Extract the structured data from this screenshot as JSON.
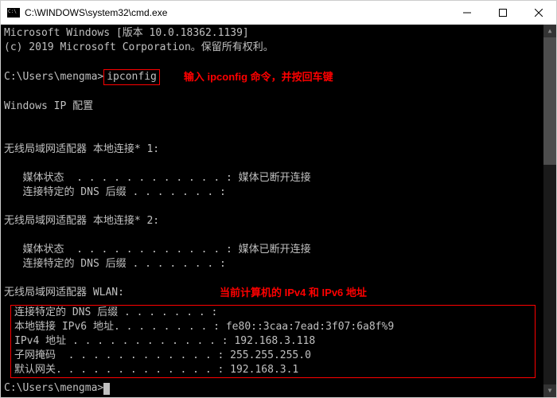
{
  "titlebar": {
    "title": "C:\\WINDOWS\\system32\\cmd.exe"
  },
  "terminal": {
    "header1": "Microsoft Windows [版本 10.0.18362.1139]",
    "header2": "(c) 2019 Microsoft Corporation。保留所有权利。",
    "prompt1_path": "C:\\Users\\mengma>",
    "command": "ipconfig",
    "annotation1": "输入 ipconfig 命令，并按回车键",
    "section_title": "Windows IP 配置",
    "adapter1_title": "无线局域网适配器 本地连接* 1:",
    "adapter1": {
      "media_label": "   媒体状态  . . . . . . . . . . . . : ",
      "media_val": "媒体已断开连接",
      "dns_label": "   连接特定的 DNS 后缀 . . . . . . . :",
      "dns_val": ""
    },
    "adapter2_title": "无线局域网适配器 本地连接* 2:",
    "adapter2": {
      "media_label": "   媒体状态  . . . . . . . . . . . . : ",
      "media_val": "媒体已断开连接",
      "dns_label": "   连接特定的 DNS 后缀 . . . . . . . :",
      "dns_val": ""
    },
    "adapter3_title": "无线局域网适配器 WLAN:",
    "annotation2": "当前计算机的 IPv4 和 IPv6 地址",
    "wlan": {
      "dns_label": "连接特定的 DNS 后缀 . . . . . . . :",
      "ipv6_label": "本地链接 IPv6 地址. . . . . . . . : ",
      "ipv6_val": "fe80::3caa:7ead:3f07:6a8f%9",
      "ipv4_label": "IPv4 地址 . . . . . . . . . . . . : ",
      "ipv4_val": "192.168.3.118",
      "mask_label": "子网掩码  . . . . . . . . . . . . : ",
      "mask_val": "255.255.255.0",
      "gw_label": "默认网关. . . . . . . . . . . . . : ",
      "gw_val": "192.168.3.1"
    },
    "prompt2_path": "C:\\Users\\mengma>"
  },
  "chart_data": {
    "type": "table",
    "title": "ipconfig output — WLAN adapter",
    "rows": [
      {
        "field": "本地链接 IPv6 地址",
        "value": "fe80::3caa:7ead:3f07:6a8f%9"
      },
      {
        "field": "IPv4 地址",
        "value": "192.168.3.118"
      },
      {
        "field": "子网掩码",
        "value": "255.255.255.0"
      },
      {
        "field": "默认网关",
        "value": "192.168.3.1"
      }
    ]
  }
}
